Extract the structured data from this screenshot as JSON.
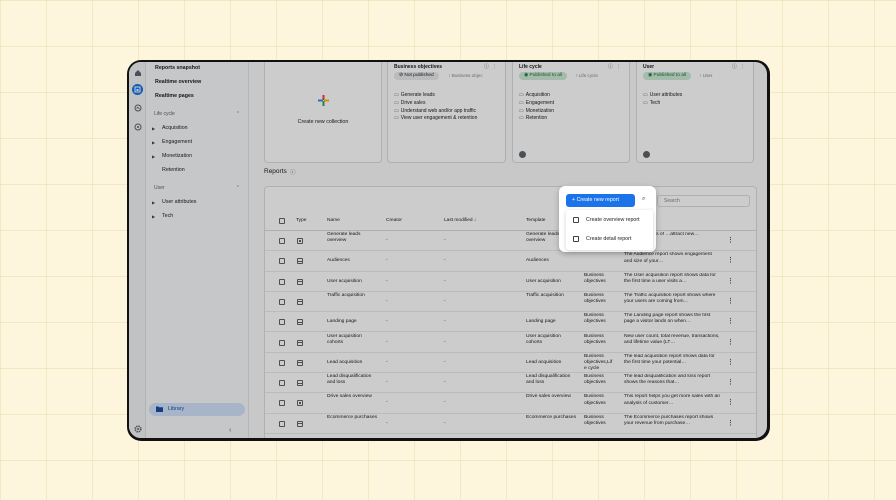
{
  "sidebar": {
    "top_items": [
      "Reports snapshot",
      "Realtime overview",
      "Realtime pages"
    ],
    "lifecycle_header": "Life cycle",
    "lifecycle_items": [
      "Acquisition",
      "Engagement",
      "Monetization",
      "Retention"
    ],
    "user_header": "User",
    "user_items": [
      "User attributes",
      "Tech"
    ],
    "library_label": "Library"
  },
  "create_collection": {
    "label": "Create new collection"
  },
  "collections": [
    {
      "title": "Business objectives",
      "chip": "Not published",
      "meta": "Business objec",
      "items": [
        "Generate leads",
        "Drive sales",
        "Understand web and/or app traffic",
        "View user engagement & retention"
      ]
    },
    {
      "title": "Life cycle",
      "chip": "Published to all",
      "meta": "Life cycle",
      "items": [
        "Acquisition",
        "Engagement",
        "Monetization",
        "Retention"
      ]
    },
    {
      "title": "User",
      "chip": "Published to all",
      "meta": "User",
      "items": [
        "User attributes",
        "Tech"
      ]
    }
  ],
  "reports": {
    "title": "Reports",
    "search_placeholder": "Search",
    "columns": {
      "type": "Type",
      "name": "Name",
      "creator": "Creator",
      "last_modified": "Last modified",
      "template": "Template"
    },
    "rows": [
      {
        "type": "overview",
        "name": "Generate leads overview",
        "creator": "-",
        "modified": "-",
        "template": "Generate leads overview",
        "collection": "",
        "desc": "…ts an analysis of …attract new…"
      },
      {
        "type": "detail",
        "name": "Audiences",
        "creator": "-",
        "modified": "-",
        "template": "Audiences",
        "collection": "",
        "desc": "The Audience report shows engagement and size of your…"
      },
      {
        "type": "detail",
        "name": "User acquisition",
        "creator": "-",
        "modified": "-",
        "template": "User acquisition",
        "collection": "Business objectives",
        "desc": "The User acquisition report shows data for the first time a user visits a…"
      },
      {
        "type": "detail",
        "name": "Traffic acquisition",
        "creator": "-",
        "modified": "-",
        "template": "Traffic acquisition",
        "collection": "Business objectives",
        "desc": "The Traffic acquisition report shows where your users are coming from…"
      },
      {
        "type": "detail",
        "name": "Landing page",
        "creator": "-",
        "modified": "-",
        "template": "Landing page",
        "collection": "Business objectives",
        "desc": "The Landing page report shows the first page a visitor lands on when…"
      },
      {
        "type": "detail",
        "name": "User acquisition cohorts",
        "creator": "-",
        "modified": "-",
        "template": "User acquisition cohorts",
        "collection": "Business objectives",
        "desc": "New user count, total revenue, transactions, and lifetime value (LT…"
      },
      {
        "type": "detail",
        "name": "Lead acquisition",
        "creator": "-",
        "modified": "-",
        "template": "Lead acquisition",
        "collection": "Business objectives,Lif e cycle",
        "desc": "The lead acquisition report shows data for the first time your potential…"
      },
      {
        "type": "detail",
        "name": "Lead disqualification and loss",
        "creator": "-",
        "modified": "-",
        "template": "Lead disqualification and loss",
        "collection": "Business objectives",
        "desc": "The lead disqualification and loss report shows the reasons that…"
      },
      {
        "type": "overview",
        "name": "Drive sales overview",
        "creator": "-",
        "modified": "-",
        "template": "Drive sales overview",
        "collection": "Business objectives",
        "desc": "This report helps you get more sales with an analysis of customer…"
      },
      {
        "type": "detail",
        "name": "Ecommerce purchases",
        "creator": "-",
        "modified": "-",
        "template": "Ecommerce purchases",
        "collection": "Business objectives",
        "desc": "The Ecommerce purchases report shows your revenue from purchase…"
      }
    ]
  },
  "popup": {
    "create_button": "Create new report",
    "menu": [
      "Create overview report",
      "Create detail report"
    ]
  },
  "colors": {
    "accent": "#1a73e8",
    "published_bg": "#ceead6",
    "published_fg": "#137333",
    "background": "#fdf5dc"
  }
}
